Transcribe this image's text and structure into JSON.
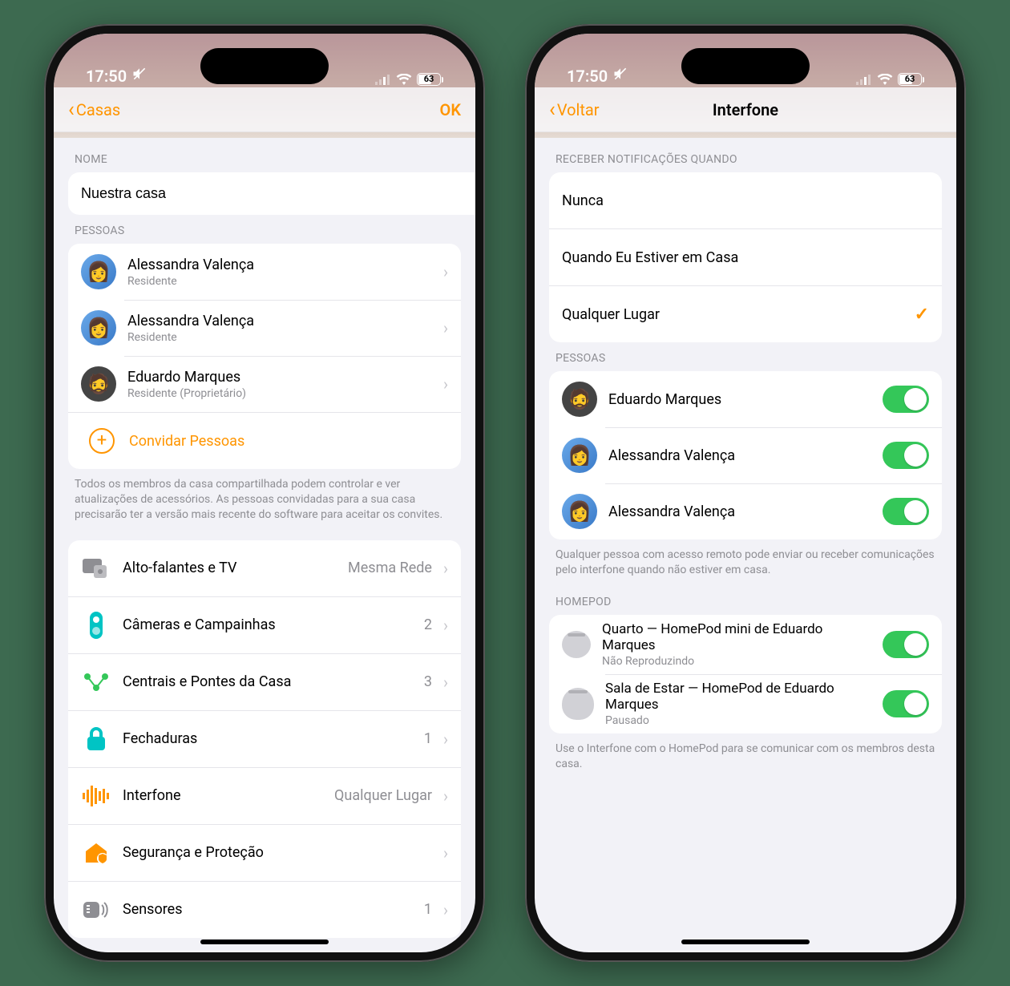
{
  "status": {
    "time": "17:50",
    "battery": "63"
  },
  "left": {
    "nav": {
      "back": "Casas",
      "ok": "OK"
    },
    "name_header": "NOME",
    "home_name": "Nuestra casa",
    "people_header": "PESSOAS",
    "people": [
      {
        "name": "Alessandra Valença",
        "role": "Residente",
        "avatar": "blue"
      },
      {
        "name": "Alessandra Valença",
        "role": "Residente",
        "avatar": "blue"
      },
      {
        "name": "Eduardo Marques",
        "role": "Residente (Proprietário)",
        "avatar": "memoji"
      }
    ],
    "invite_label": "Convidar Pessoas",
    "people_footer": "Todos os membros da casa compartilhada podem controlar e ver atualizações de acessórios. As pessoas convidadas para a sua casa precisarão ter a versão mais recente do software para aceitar os convites.",
    "settings": [
      {
        "label": "Alto-falantes e TV",
        "detail": "Mesma Rede",
        "icon": "speaker-tv"
      },
      {
        "label": "Câmeras e Campainhas",
        "detail": "2",
        "icon": "camera-bell"
      },
      {
        "label": "Centrais e Pontes da Casa",
        "detail": "3",
        "icon": "hub"
      },
      {
        "label": "Fechaduras",
        "detail": "1",
        "icon": "lock"
      },
      {
        "label": "Interfone",
        "detail": "Qualquer Lugar",
        "icon": "intercom"
      },
      {
        "label": "Segurança e Proteção",
        "detail": "",
        "icon": "security"
      },
      {
        "label": "Sensores",
        "detail": "1",
        "icon": "sensor"
      }
    ]
  },
  "right": {
    "nav": {
      "back": "Voltar",
      "title": "Interfone"
    },
    "notify_header": "RECEBER NOTIFICAÇÕES QUANDO",
    "notify_options": [
      {
        "label": "Nunca",
        "selected": false
      },
      {
        "label": "Quando Eu Estiver em Casa",
        "selected": false
      },
      {
        "label": "Qualquer Lugar",
        "selected": true
      }
    ],
    "people_header": "PESSOAS",
    "people": [
      {
        "name": "Eduardo Marques",
        "avatar": "memoji",
        "on": true
      },
      {
        "name": "Alessandra Valença",
        "avatar": "blue",
        "on": true
      },
      {
        "name": "Alessandra Valença",
        "avatar": "blue",
        "on": true
      }
    ],
    "people_footer": "Qualquer pessoa com acesso remoto pode enviar ou receber comunicações pelo interfone quando não estiver em casa.",
    "homepod_header": "HOMEPOD",
    "homepods": [
      {
        "name": "Quarto — HomePod mini de Eduardo Marques",
        "status": "Não Reproduzindo",
        "mini": true,
        "on": true
      },
      {
        "name": "Sala de Estar — HomePod de Eduardo Marques",
        "status": "Pausado",
        "mini": false,
        "on": true
      }
    ],
    "homepod_footer": "Use o Interfone com o HomePod para se comunicar com os membros desta casa."
  }
}
